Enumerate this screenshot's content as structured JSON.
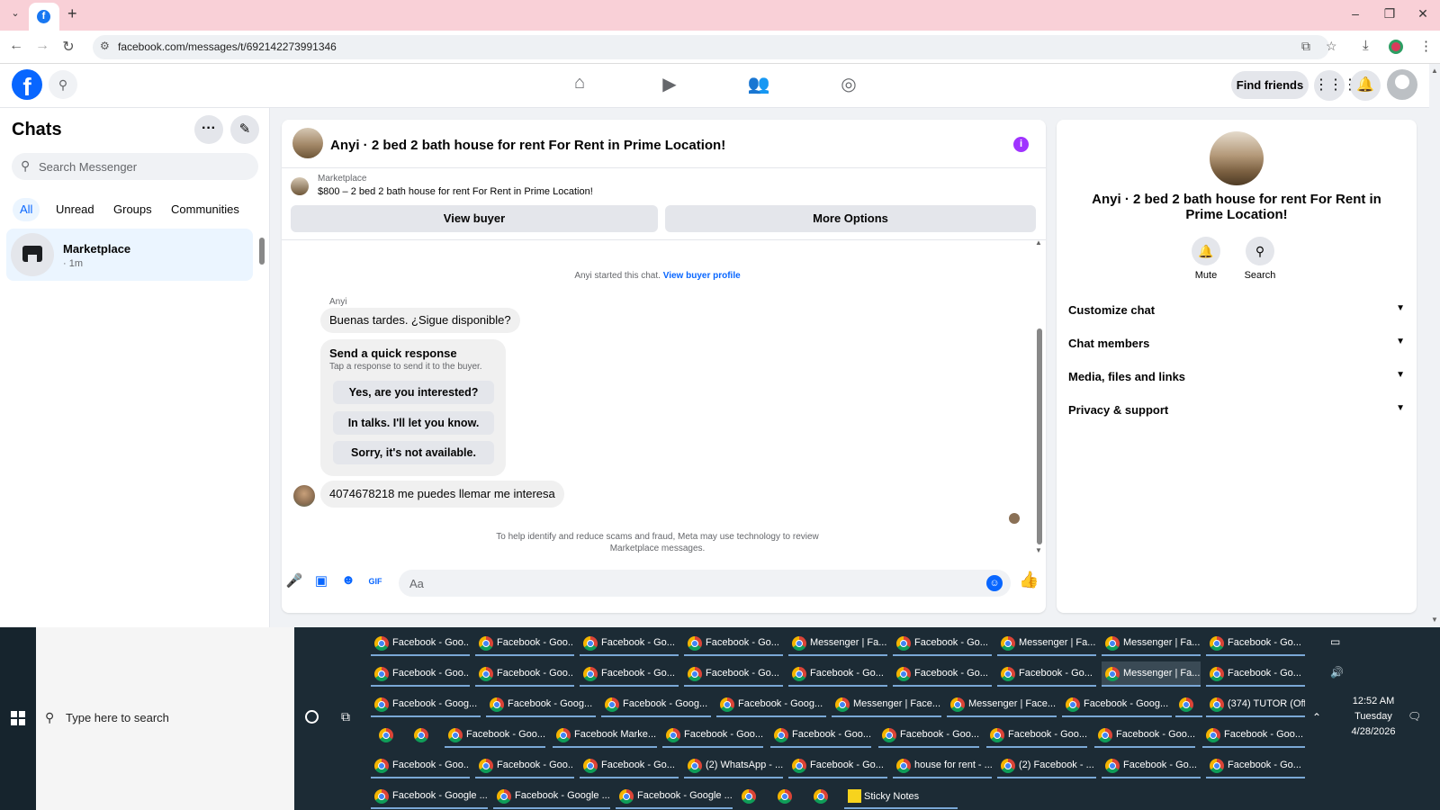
{
  "browser": {
    "tab_dropdown_icon": "chevron-down-icon",
    "new_tab": "+",
    "url": "facebook.com/messages/t/692142273991346",
    "win_min": "–",
    "win_restore": "❐",
    "win_close": "✕"
  },
  "fb_header": {
    "find_friends": "Find friends"
  },
  "chats": {
    "title": "Chats",
    "search_placeholder": "Search Messenger",
    "filters": [
      "All",
      "Unread",
      "Groups",
      "Communities"
    ],
    "items": [
      {
        "name": "Marketplace",
        "time": "· 1m"
      }
    ]
  },
  "conversation": {
    "title": "Anyi · 2 bed 2 bath house for rent For Rent in Prime Location!",
    "listing_label": "Marketplace",
    "listing_title": "$800 – 2 bed 2 bath house for rent For Rent in Prime Location!",
    "view_buyer": "View buyer",
    "more_options": "More Options",
    "started_text": "Anyi started this chat.",
    "view_buyer_profile": "View buyer profile",
    "sender_name": "Anyi",
    "message_1": "Buenas tardes. ¿Sigue disponible?",
    "quick_title": "Send a quick response",
    "quick_sub": "Tap a response to send it to the buyer.",
    "quick_options": [
      "Yes, are you interested?",
      "In talks. I'll let you know.",
      "Sorry, it's not available."
    ],
    "message_2": "4074678218 me puedes llemar me interesa",
    "notice_line1": "To help identify and reduce scams and fraud, Meta may use technology to review",
    "notice_line2": "Marketplace messages.",
    "composer_placeholder": "Aa"
  },
  "details": {
    "title": "Anyi · 2 bed 2 bath house for rent For Rent in Prime Location!",
    "mute": "Mute",
    "search": "Search",
    "rows": [
      "Customize chat",
      "Chat members",
      "Media, files and links",
      "Privacy & support"
    ]
  },
  "taskbar": {
    "search_text": "Type here to search",
    "rows": [
      [
        "Facebook - Goo...",
        "Facebook - Goo...",
        "Facebook - Go...",
        "Facebook - Go...",
        "Messenger | Fa...",
        "Facebook - Go...",
        "Messenger | Fa...",
        "Messenger | Fa...",
        "Facebook - Go..."
      ],
      [
        "Facebook - Goo...",
        "Facebook - Goo...",
        "Facebook - Go...",
        "Facebook - Go...",
        "Facebook - Go...",
        "Facebook - Go...",
        "Facebook - Go...",
        "Messenger | Fa...",
        "Facebook - Go..."
      ],
      [
        "Facebook - Goog...",
        "Facebook - Goog...",
        "Facebook - Goog...",
        "Facebook - Goog...",
        "Messenger | Face...",
        "Messenger | Face...",
        "Facebook - Goog...",
        "",
        "(374) TUTOR (Offi..."
      ],
      [
        "",
        "",
        "Facebook - Goo...",
        "Facebook Marke...",
        "Facebook - Goo...",
        "Facebook - Goo...",
        "Facebook - Goo...",
        "Facebook - Goo...",
        "Facebook - Goo...",
        "Facebook - Goo..."
      ],
      [
        "Facebook - Goo...",
        "Facebook - Goo...",
        "Facebook - Go...",
        "(2) WhatsApp - ...",
        "Facebook - Go...",
        "house for rent - ...",
        "(2) Facebook - ...",
        "Facebook - Go...",
        "Facebook - Go..."
      ],
      [
        "Facebook - Google ...",
        "Facebook - Google ...",
        "Facebook - Google ...",
        "",
        "",
        ""
      ]
    ],
    "sticky_notes": "Sticky Notes",
    "time": "12:52 AM",
    "day": "Tuesday",
    "date": "4/28/2026"
  }
}
